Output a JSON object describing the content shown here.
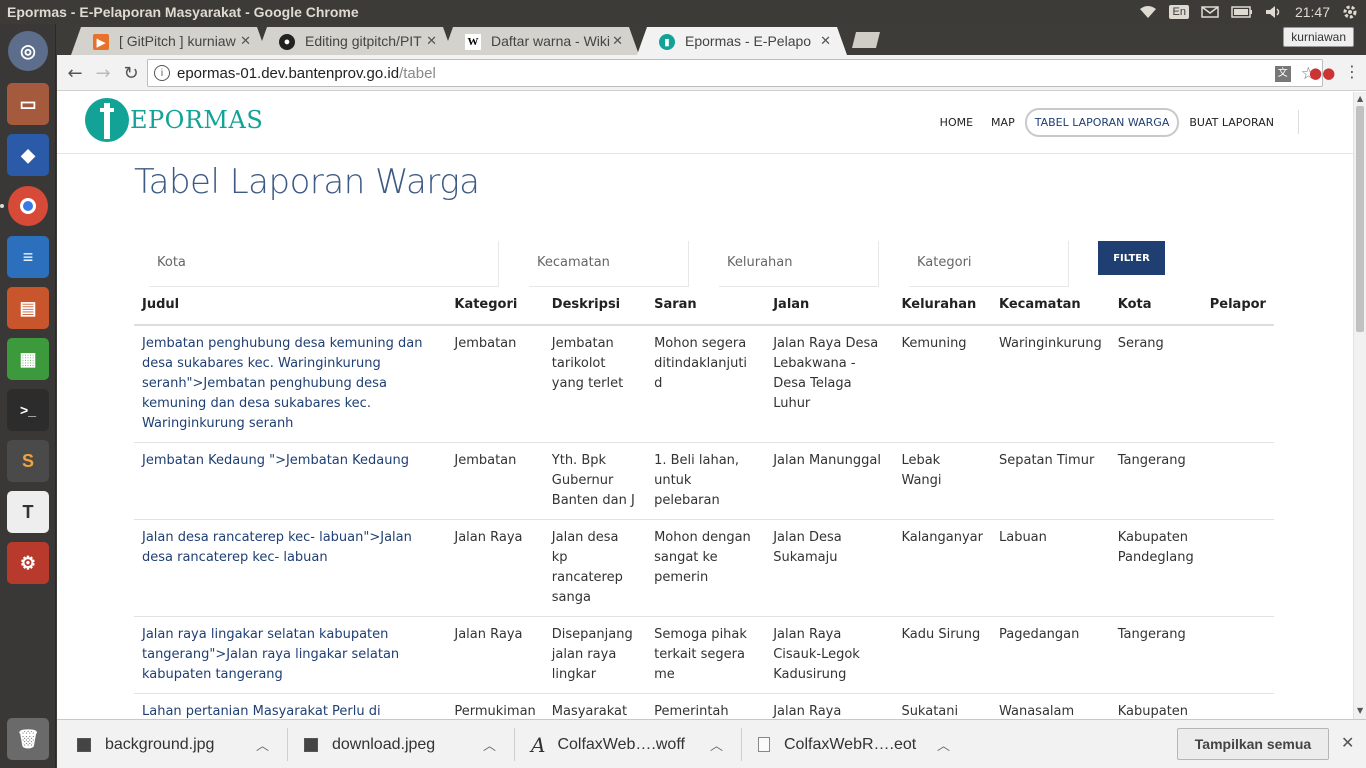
{
  "window": {
    "title": "Epormas - E-Pelaporan Masyarakat - Google Chrome"
  },
  "tray": {
    "lang": "En",
    "time": "21:47"
  },
  "tabs": [
    {
      "label": "[ GitPitch ] kurniaw",
      "icon": "gitpitch-icon"
    },
    {
      "label": "Editing gitpitch/PIT",
      "icon": "github-icon"
    },
    {
      "label": "Daftar warna - Wiki",
      "icon": "wikipedia-icon"
    },
    {
      "label": "Epormas - E-Pelapo",
      "icon": "epormas-icon"
    }
  ],
  "profile": "kurniawan",
  "url": {
    "host": "epormas-01.dev.bantenprov.go.id",
    "path": "/tabel"
  },
  "site": {
    "logo": "EPORMAS",
    "nav": [
      "HOME",
      "MAP",
      "TABEL LAPORAN WARGA",
      "BUAT LAPORAN"
    ],
    "title": "Tabel Laporan Warga"
  },
  "filters": {
    "kota": "Kota",
    "kecamatan": "Kecamatan",
    "kelurahan": "Kelurahan",
    "kategori": "Kategori",
    "button": "FILTER"
  },
  "table": {
    "headers": [
      "Judul",
      "Kategori",
      "Deskripsi",
      "Saran",
      "Jalan",
      "Kelurahan",
      "Kecamatan",
      "Kota",
      "Pelapor"
    ],
    "rows": [
      [
        "Jembatan penghubung desa kemuning dan desa sukabares kec. Waringinkurung seranh\">Jembatan penghubung desa kemuning dan desa sukabares kec. Waringinkurung seranh",
        "Jembatan",
        "Jembatan tarikolot yang terlet",
        "Mohon segera ditindaklanjuti d",
        "Jalan Raya Desa Lebakwana - Desa Telaga Luhur",
        "Kemuning",
        "Waringinkurung",
        "Serang",
        ""
      ],
      [
        "Jembatan Kedaung \">Jembatan Kedaung",
        "Jembatan",
        "Yth. Bpk Gubernur Banten dan J",
        "1. Beli lahan, untuk pelebaran",
        "Jalan Manunggal",
        "Lebak Wangi",
        "Sepatan Timur",
        "Tangerang",
        ""
      ],
      [
        "Jalan desa rancaterep kec- labuan\">Jalan desa rancaterep kec- labuan",
        "Jalan Raya",
        "Jalan desa kp rancaterep sanga",
        "Mohon dengan sangat ke pemerin",
        "Jalan Desa Sukamaju",
        "Kalanganyar",
        "Labuan",
        "Kabupaten Pandeglang",
        ""
      ],
      [
        "Jalan raya lingakar selatan kabupaten tangerang\">Jalan raya lingakar selatan kabupaten tangerang",
        "Jalan Raya",
        "Disepanjang jalan raya lingkar",
        "Semoga pihak terkait segera me",
        "Jalan Raya Cisauk-Legok Kadusirung",
        "Kadu Sirung",
        "Pagedangan",
        "Tangerang",
        ""
      ],
      [
        "Lahan pertanian Masyarakat Perlu di perhatikan\">Lahan pertanian Masyarakat Perlu di perhatikan",
        "Permukiman dan Lahan",
        "Masyarakat masih kesulitan men",
        "Pemerintah harus memperhatikan",
        "Jalan Raya Binuangeun-Malingping",
        "Sukatani",
        "Wanasalam",
        "Kabupaten Lebak",
        ""
      ]
    ]
  },
  "downloads": {
    "items": [
      "background.jpg",
      "download.jpeg",
      "ColfaxWeb….woff",
      "ColfaxWebR….eot"
    ],
    "show_all": "Tampilkan semua"
  }
}
